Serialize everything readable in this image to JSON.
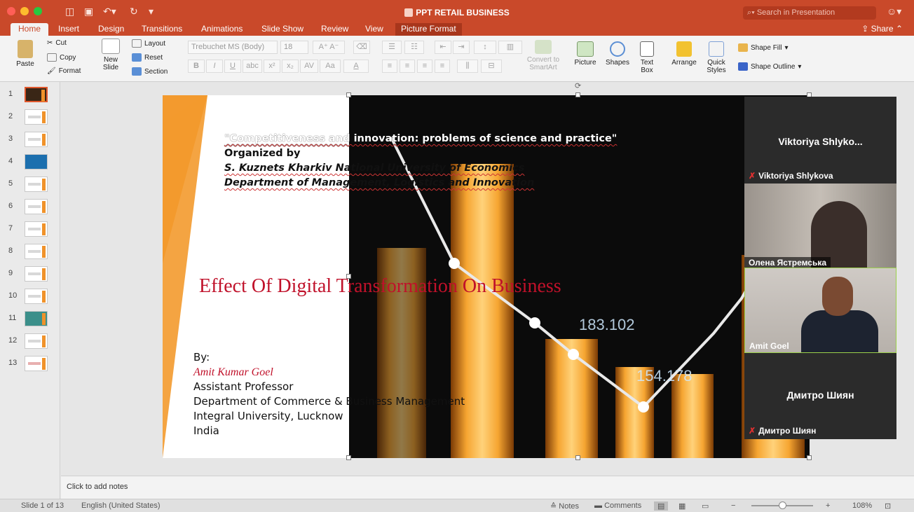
{
  "window": {
    "title": "PPT RETAIL BUSINESS",
    "search_placeholder": "Search in Presentation",
    "share_label": "Share"
  },
  "tabs": [
    "Home",
    "Insert",
    "Design",
    "Transitions",
    "Animations",
    "Slide Show",
    "Review",
    "View",
    "Picture Format"
  ],
  "ribbon": {
    "paste": "Paste",
    "cut": "Cut",
    "copy": "Copy",
    "format": "Format",
    "new_slide_1": "New",
    "new_slide_2": "Slide",
    "layout": "Layout",
    "reset": "Reset",
    "section": "Section",
    "font_name": "Trebuchet MS (Body)",
    "font_size": "18",
    "convert_1": "Convert to",
    "convert_2": "SmartArt",
    "picture": "Picture",
    "shapes": "Shapes",
    "textbox_1": "Text",
    "textbox_2": "Box",
    "arrange": "Arrange",
    "quick_1": "Quick",
    "quick_2": "Styles",
    "shape_fill": "Shape Fill",
    "shape_outline": "Shape Outline"
  },
  "thumbnails": [
    "1",
    "2",
    "3",
    "4",
    "5",
    "6",
    "7",
    "8",
    "9",
    "10",
    "11",
    "12",
    "13"
  ],
  "slide": {
    "conf_title": "\"Competitiveness and innovation: problems of science and practice\"",
    "organized_by": "Organized by",
    "university": "S. Kuznets Kharkiv National University of Economics",
    "department": "Department of Management, Logistics and Innovation",
    "main_title": "Effect Of Digital Transformation On Business",
    "by": "By:",
    "author": "Amit Kumar Goel",
    "role": "Assistant Professor",
    "dept2": "Department of Commerce & Business Management",
    "org": "Integral University, Lucknow",
    "country": "India",
    "chart_values": [
      "183.102",
      "154.178"
    ]
  },
  "notes_placeholder": "Click to add notes",
  "status": {
    "slide_info": "Slide 1 of 13",
    "language": "English (United States)",
    "notes": "Notes",
    "comments": "Comments",
    "zoom": "108%"
  },
  "participants": [
    {
      "title": "Viktoriya  Shlyko...",
      "label": "Viktoriya Shlykova",
      "muted": true
    },
    {
      "label": "Олена Ястремська",
      "muted": false
    },
    {
      "label": "Amit Goel",
      "muted": false
    },
    {
      "title": "Дмитро Шиян",
      "label": "Дмитро Шиян",
      "muted": true
    }
  ]
}
